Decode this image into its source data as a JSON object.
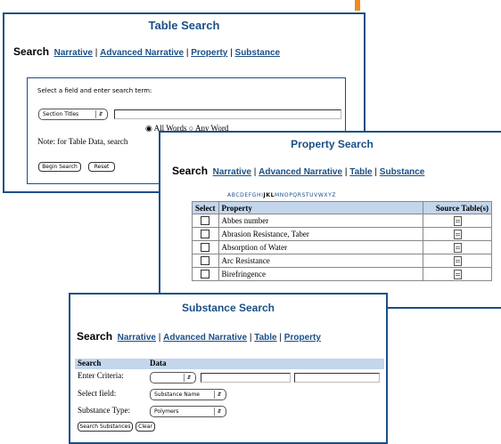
{
  "accent_color": "#1b4f86",
  "header_color": "#c3d6ec",
  "orange_color": "#f08a1e",
  "table_search": {
    "title": "Table Search",
    "search_label": "Search",
    "links": [
      "Narrative",
      "Advanced Narrative",
      "Property",
      "Substance"
    ],
    "instruction": "Select a field and enter search term:",
    "field_select": "Section Titles",
    "radio_all": "All Words",
    "radio_any": "Any Word",
    "note": "Note: for Table Data, search",
    "begin_button": "Begin Search",
    "reset_button": "Reset"
  },
  "property_search": {
    "title": "Property Search",
    "search_label": "Search",
    "links": [
      "Narrative",
      "Advanced Narrative",
      "Table",
      "Substance"
    ],
    "alphabet_before": "ABCDEFGHI",
    "alphabet_bold": "JKL",
    "alphabet_after": "MNOPQRSTUVWXYZ",
    "columns": [
      "Select",
      "Property",
      "Source Table(s)"
    ],
    "rows": [
      "Abbes number",
      "Abrasion Resistance, Taber",
      "Absorption of Water",
      "Arc Resistance",
      "Birefringence"
    ]
  },
  "substance_search": {
    "title": "Substance Search",
    "search_label": "Search",
    "links": [
      "Narrative",
      "Advanced Narrative",
      "Table",
      "Property"
    ],
    "columns": [
      "Search",
      "Data"
    ],
    "enter_criteria_label": "Enter Criteria:",
    "select_field_label": "Select field:",
    "select_field_value": "Substance Name",
    "substance_type_label": "Substance Type:",
    "substance_type_value": "Polymers",
    "search_button": "Search Substances",
    "clear_button": "Clear"
  }
}
